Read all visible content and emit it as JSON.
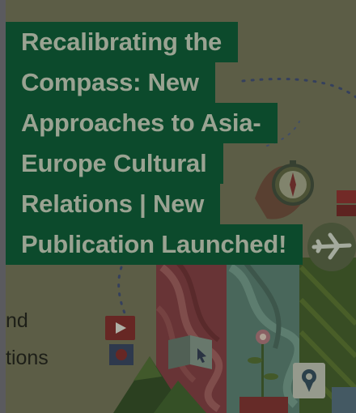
{
  "post": {
    "title_lines": [
      "Recalibrating the",
      "Compass: New",
      "Approaches to Asia-",
      "Europe Cultural",
      "Relations | New",
      "Publication Launched!"
    ]
  },
  "cover": {
    "partial_text_lines": [
      "nd",
      "tions"
    ]
  },
  "colors": {
    "title_background": "#0c4a2c",
    "title_text": "#9aa392",
    "background": "#6e6f55"
  },
  "icons": [
    "compass-icon",
    "airplane-icon",
    "book-icon",
    "play-icon",
    "location-pin-icon",
    "music-note-icon"
  ]
}
